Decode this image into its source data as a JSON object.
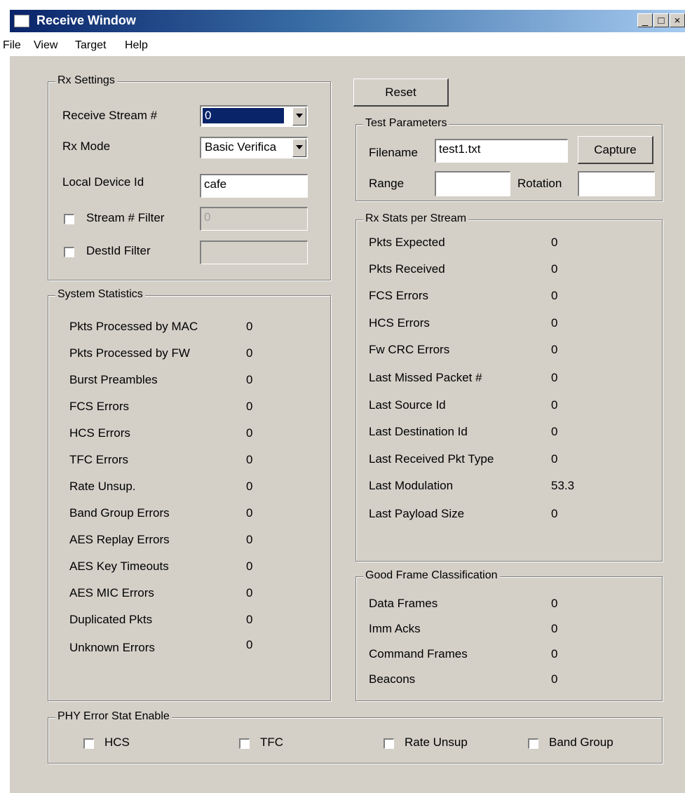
{
  "window": {
    "title": "Receive Window",
    "icon": "app-window-icon",
    "minimize": "_",
    "maximize": "□",
    "close": "×"
  },
  "menu": [
    "File",
    "View",
    "Target",
    "Help"
  ],
  "rx_settings": {
    "title": "Rx Settings",
    "receive_stream_label": "Receive Stream #",
    "receive_stream_value": "0",
    "rx_mode_label": "Rx Mode",
    "rx_mode_value": "Basic Verifica",
    "local_device_label": "Local Device Id",
    "local_device_value": "cafe",
    "stream_filter_label": "Stream # Filter",
    "stream_filter_value": "0",
    "destid_filter_label": "DestId Filter",
    "destid_filter_value": ""
  },
  "reset_label": "Reset",
  "test_params": {
    "title": "Test Parameters",
    "filename_label": "Filename",
    "filename_value": "test1.txt",
    "capture_label": "Capture",
    "range_label": "Range",
    "range_value": "",
    "rotation_label": "Rotation",
    "rotation_value": ""
  },
  "system_stats": {
    "title": "System Statistics",
    "rows": [
      {
        "label": "Pkts Processed by MAC",
        "value": "0"
      },
      {
        "label": "Pkts Processed by FW",
        "value": "0"
      },
      {
        "label": "Burst Preambles",
        "value": "0"
      },
      {
        "label": "FCS Errors",
        "value": "0"
      },
      {
        "label": "HCS Errors",
        "value": "0"
      },
      {
        "label": "TFC Errors",
        "value": "0"
      },
      {
        "label": "Rate Unsup.",
        "value": "0"
      },
      {
        "label": "Band Group Errors",
        "value": "0"
      },
      {
        "label": "AES Replay Errors",
        "value": "0"
      },
      {
        "label": "AES Key Timeouts",
        "value": "0"
      },
      {
        "label": "AES MIC Errors",
        "value": "0"
      },
      {
        "label": "Duplicated Pkts",
        "value": "0"
      },
      {
        "label": "Unknown Errors",
        "value": "0"
      }
    ]
  },
  "rx_stats": {
    "title": "Rx Stats per Stream",
    "rows": [
      {
        "label": "Pkts Expected",
        "value": "0"
      },
      {
        "label": "Pkts Received",
        "value": "0"
      },
      {
        "label": "FCS Errors",
        "value": "0"
      },
      {
        "label": "HCS Errors",
        "value": "0"
      },
      {
        "label": "Fw CRC Errors",
        "value": "0"
      },
      {
        "label": "Last Missed Packet #",
        "value": "0"
      },
      {
        "label": "Last Source Id",
        "value": "0"
      },
      {
        "label": "Last Destination Id",
        "value": "0"
      },
      {
        "label": "Last Received Pkt Type",
        "value": "0"
      },
      {
        "label": "Last Modulation",
        "value": "53.3"
      },
      {
        "label": "Last Payload Size",
        "value": "0"
      }
    ]
  },
  "good_frames": {
    "title": "Good Frame Classification",
    "rows": [
      {
        "label": "Data Frames",
        "value": "0"
      },
      {
        "label": "Imm Acks",
        "value": "0"
      },
      {
        "label": "Command Frames",
        "value": "0"
      },
      {
        "label": "Beacons",
        "value": "0"
      }
    ]
  },
  "phy_error": {
    "title": "PHY Error Stat Enable",
    "options": [
      "HCS",
      "TFC",
      "Rate Unsup",
      "Band Group"
    ]
  },
  "colors": {
    "face": "#d4d0c8",
    "selection": "#0a246a",
    "title_start": "#0a246a",
    "title_end": "#a6caf0"
  }
}
